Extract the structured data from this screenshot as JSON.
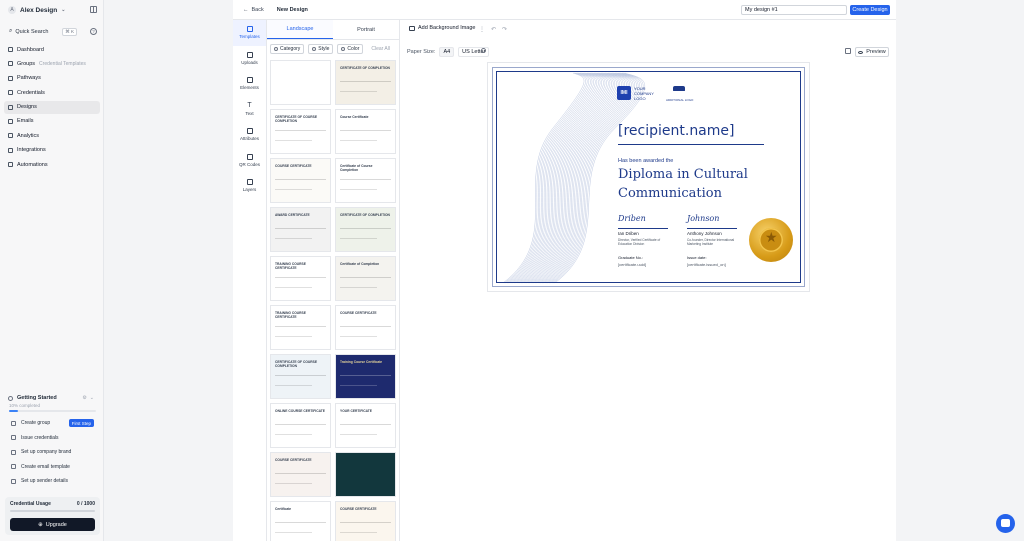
{
  "account": {
    "initial": "A",
    "name": "Alex Design"
  },
  "search": {
    "label": "Quick Search",
    "shortcut": "⌘ K"
  },
  "nav": [
    {
      "label": "Dashboard",
      "sub": ""
    },
    {
      "label": "Groups",
      "sub": "Credential Templates"
    },
    {
      "label": "Pathways",
      "sub": ""
    },
    {
      "label": "Credentials",
      "sub": ""
    },
    {
      "label": "Designs",
      "sub": ""
    },
    {
      "label": "Emails",
      "sub": ""
    },
    {
      "label": "Analytics",
      "sub": ""
    },
    {
      "label": "Integrations",
      "sub": ""
    },
    {
      "label": "Automations",
      "sub": ""
    }
  ],
  "getting_started": {
    "title": "Getting Started",
    "progress_text": "10% completed",
    "progress": 0.1,
    "items": [
      {
        "label": "Create group",
        "badge": "First Step"
      },
      {
        "label": "Issue credentials",
        "badge": ""
      },
      {
        "label": "Set up company brand",
        "badge": ""
      },
      {
        "label": "Create email template",
        "badge": ""
      },
      {
        "label": "Set up sender details",
        "badge": ""
      }
    ]
  },
  "usage": {
    "label": "Credential Usage",
    "count": "0 / 1000",
    "fraction": 0,
    "upgrade": "Upgrade"
  },
  "topbar": {
    "back": "Back",
    "title": "New Design",
    "design_name": "My design #1",
    "create": "Create Design"
  },
  "rail": [
    "Templates",
    "Uploads",
    "Elements",
    "Text",
    "Attributes",
    "QR Codes",
    "Layers"
  ],
  "panel": {
    "tabs": [
      "Landscape",
      "Portrait"
    ],
    "filters": [
      "Category",
      "Style",
      "Color"
    ],
    "clear": "Clear All",
    "thumbs": [
      {
        "title": "",
        "bg": "#ffffff"
      },
      {
        "title": "CERTIFICATE OF COMPLETION",
        "bg": "#f3efe6"
      },
      {
        "title": "CERTIFICATE OF COURSE COMPLETION",
        "bg": "#ffffff"
      },
      {
        "title": "Course Certificate",
        "bg": "#ffffff"
      },
      {
        "title": "COURSE CERTIFICATE",
        "bg": "#fbfaf7"
      },
      {
        "title": "Certificate of Course Completion",
        "bg": "#ffffff"
      },
      {
        "title": "AWARD CERTIFICATE",
        "bg": "#f2f2f2"
      },
      {
        "title": "CERTIFICATE OF COMPLETION",
        "bg": "#eef2ea"
      },
      {
        "title": "TRAINING COURSE CERTIFICATE",
        "bg": "#ffffff"
      },
      {
        "title": "Certificate of Completion",
        "bg": "#f4f3ef"
      },
      {
        "title": "TRAINING COURSE CERTIFICATE",
        "bg": "#ffffff"
      },
      {
        "title": "COURSE CERTIFICATE",
        "bg": "#ffffff"
      },
      {
        "title": "CERTIFICATE OF COURSE COMPLETION",
        "bg": "#eef3f7"
      },
      {
        "title": "Training Course Certificate",
        "bg": "#1e2a6e"
      },
      {
        "title": "ONLINE COURSE CERTIFICATE",
        "bg": "#ffffff"
      },
      {
        "title": "YOUR CERTIFICATE",
        "bg": "#ffffff"
      },
      {
        "title": "COURSE CERTIFICATE",
        "bg": "#f7f2ef"
      },
      {
        "title": "",
        "bg": "#12373d"
      },
      {
        "title": "Certificate",
        "bg": "#ffffff"
      },
      {
        "title": "COURSE CERTIFICATE",
        "bg": "#fbf6ee"
      }
    ]
  },
  "canvas": {
    "bg_button": "Add Background Image",
    "paper_label": "Paper Size:",
    "paper_options": [
      "A4",
      "US Letter"
    ],
    "preview": "Preview"
  },
  "certificate": {
    "logo_initials": "IMI",
    "logo_text": [
      "YOUR",
      "COMPANY",
      "LOGO"
    ],
    "additional_logo": "ADDITIONAL LOGO",
    "recipient": "[recipient.name]",
    "awarded": "Has been awarded the",
    "title": "Diploma in Cultural Communication",
    "signers": [
      {
        "signature": "Driben",
        "name": "Ian Driben",
        "title": "Director, Verified Certificate of Education Division"
      },
      {
        "signature": "Johnson",
        "name": "Anthony Johnson",
        "title": "Co-founder, Director International Marketing Institute"
      }
    ],
    "graduate_label": "Graduate No.:",
    "graduate_value": "[certificate.uuid]",
    "issue_label": "Issue date:",
    "issue_value": "[certificate.issued_on]"
  }
}
